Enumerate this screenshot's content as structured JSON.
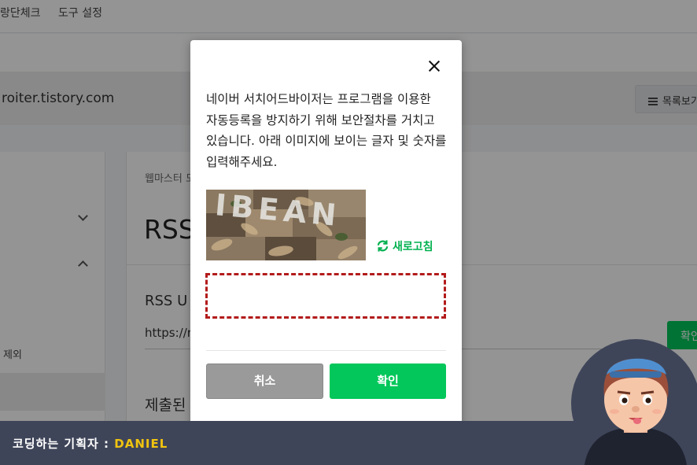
{
  "topnav": {
    "item1": "랑단체크",
    "item2": "도구 설정"
  },
  "site": {
    "url": "roiter.tistory.com",
    "list_button": "목록보기"
  },
  "sidebar": {
    "item_text": "제외"
  },
  "content": {
    "breadcrumb": "웹마스터 도구",
    "title": "RSS",
    "rss_label": "RSS U",
    "rss_value": "https://r",
    "confirm_label": "확인",
    "submitted_label": "제출된"
  },
  "modal": {
    "message": "네이버 서치어드바이저는 프로그램을 이용한 자동등록을 방지하기 위해 보안절차를 거치고 있습니다. 아래 이미지에 보이는 글자 및 숫자를 입력해주세요.",
    "captcha_text": "IBEAN",
    "refresh_label": "새로고침",
    "input_value": "",
    "cancel_label": "취소",
    "confirm_label": "확인"
  },
  "banner": {
    "prefix": "코딩하는 기획자 : ",
    "name": "DANIEL"
  },
  "colors": {
    "accent": "#03c75a",
    "dashed_border": "#b31b1b",
    "banner_bg": "#3f4559",
    "banner_name": "#f1c40f"
  }
}
